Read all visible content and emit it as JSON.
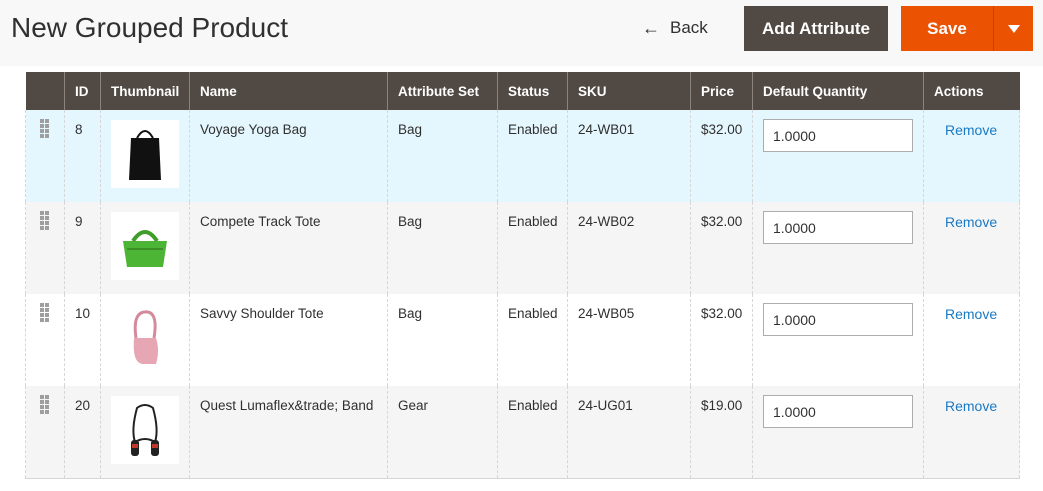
{
  "page": {
    "title": "New Grouped Product"
  },
  "toolbar": {
    "back_label": "Back",
    "back_icon": "arrow-left-icon",
    "add_attribute_label": "Add Attribute",
    "save_label": "Save",
    "save_menu_icon": "caret-down-icon"
  },
  "colors": {
    "accent": "#eb5202",
    "header_dark": "#514943",
    "link": "#1979c3",
    "highlight_row": "#e5f7fe"
  },
  "grid": {
    "columns": [
      "",
      "ID",
      "Thumbnail",
      "Name",
      "Attribute Set",
      "Status",
      "SKU",
      "Price",
      "Default Quantity",
      "Actions"
    ],
    "rows": [
      {
        "id": "8",
        "name": "Voyage Yoga Bag",
        "attribute_set": "Bag",
        "status": "Enabled",
        "sku": "24-WB01",
        "price": "$32.00",
        "qty": "1.0000",
        "action": "Remove",
        "thumbnail": "black-tote-bag"
      },
      {
        "id": "9",
        "name": "Compete Track Tote",
        "attribute_set": "Bag",
        "status": "Enabled",
        "sku": "24-WB02",
        "price": "$32.00",
        "qty": "1.0000",
        "action": "Remove",
        "thumbnail": "green-tote-bag"
      },
      {
        "id": "10",
        "name": "Savvy Shoulder Tote",
        "attribute_set": "Bag",
        "status": "Enabled",
        "sku": "24-WB05",
        "price": "$32.00",
        "qty": "1.0000",
        "action": "Remove",
        "thumbnail": "pink-shoulder-bag"
      },
      {
        "id": "20",
        "name": "Quest Lumaflex&trade; Band",
        "attribute_set": "Gear",
        "status": "Enabled",
        "sku": "24-UG01",
        "price": "$19.00",
        "qty": "1.0000",
        "action": "Remove",
        "thumbnail": "resistance-band"
      }
    ]
  }
}
